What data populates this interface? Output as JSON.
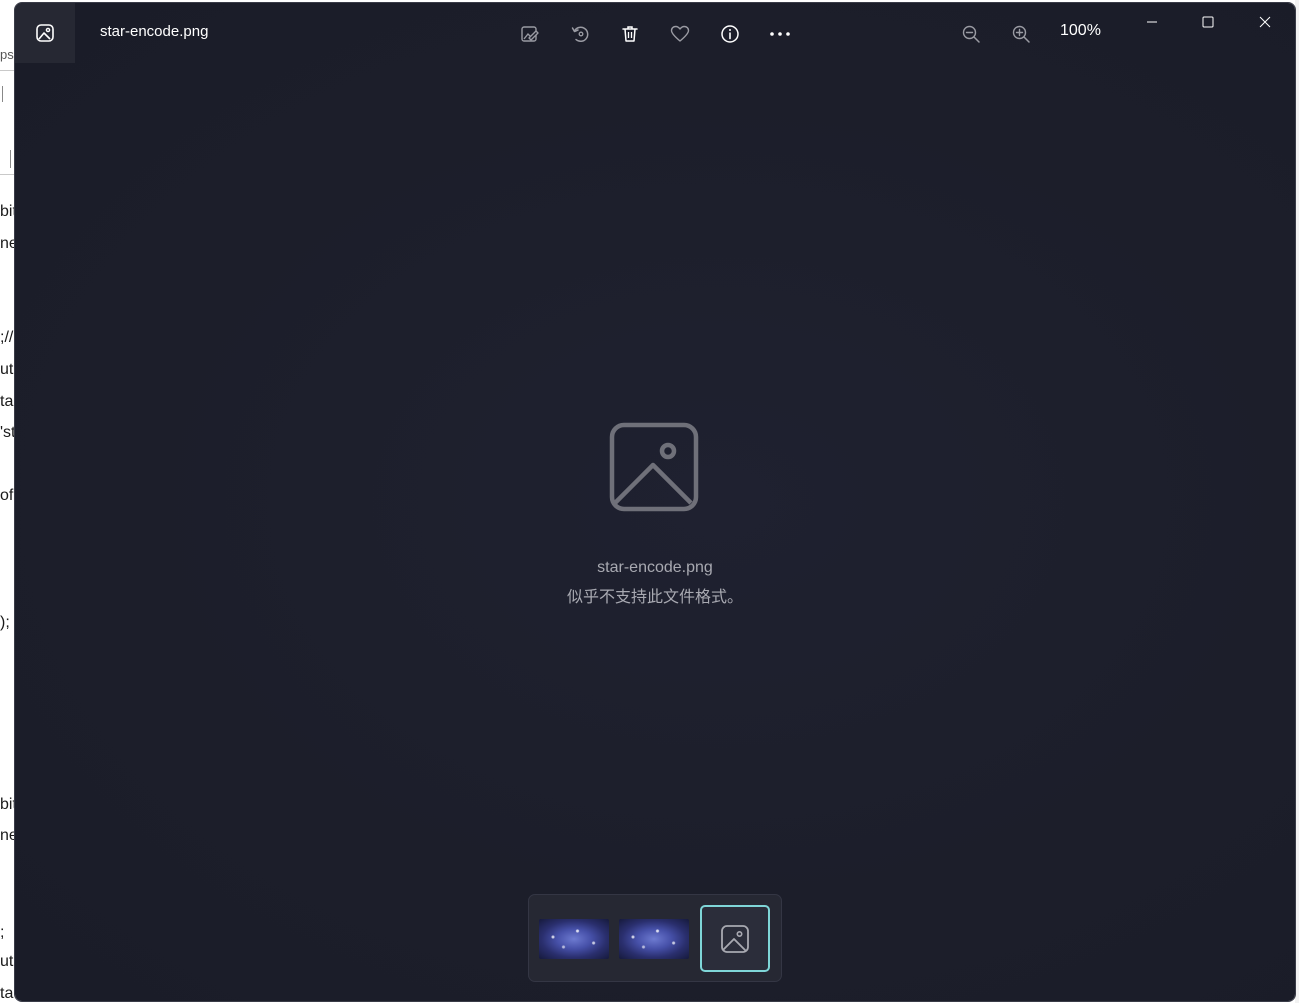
{
  "background_app": {
    "fragments": [
      "ps",
      "bit",
      "nes",
      ";//",
      "ut;",
      "ta",
      "'st",
      "of",
      ");",
      "bit",
      "nes",
      ";",
      "ut;",
      "ta"
    ]
  },
  "viewer": {
    "title": "star-encode.png",
    "zoom": "100%",
    "toolbar": {
      "icons": [
        "edit-image-icon",
        "rotate-icon",
        "delete-icon",
        "favorite-icon",
        "info-icon",
        "more-icon"
      ]
    },
    "placeholder": {
      "filename": "star-encode.png",
      "message": "似乎不支持此文件格式。"
    },
    "filmstrip": {
      "selected_index": 2,
      "count": 3
    },
    "colors": {
      "background": "#1d1f2b",
      "accent": "#7fd6d8",
      "text": "#ffffff",
      "muted_text": "#a8a9b1"
    }
  }
}
